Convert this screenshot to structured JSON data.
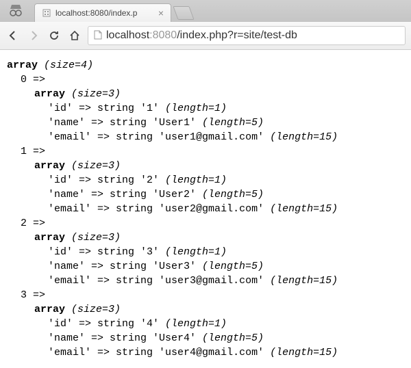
{
  "browser": {
    "tab_title": "localhost:8080/index.p",
    "url_host": "localhost",
    "url_port": ":8080",
    "url_path": "/index.php?r=site/test-db"
  },
  "dump": {
    "keyword_array": "array",
    "keyword_size_open": "(size=",
    "keyword_size_close": ")",
    "keyword_string": "string",
    "keyword_length_open": "(length=",
    "keyword_length_close": ")",
    "arrow": "=>",
    "outer_size": "4",
    "inner_size": "3",
    "items": [
      {
        "index": "0",
        "fields": [
          {
            "key": "'id'",
            "value": "'1'",
            "len": "1"
          },
          {
            "key": "'name'",
            "value": "'User1'",
            "len": "5"
          },
          {
            "key": "'email'",
            "value": "'user1@gmail.com'",
            "len": "15"
          }
        ]
      },
      {
        "index": "1",
        "fields": [
          {
            "key": "'id'",
            "value": "'2'",
            "len": "1"
          },
          {
            "key": "'name'",
            "value": "'User2'",
            "len": "5"
          },
          {
            "key": "'email'",
            "value": "'user2@gmail.com'",
            "len": "15"
          }
        ]
      },
      {
        "index": "2",
        "fields": [
          {
            "key": "'id'",
            "value": "'3'",
            "len": "1"
          },
          {
            "key": "'name'",
            "value": "'User3'",
            "len": "5"
          },
          {
            "key": "'email'",
            "value": "'user3@gmail.com'",
            "len": "15"
          }
        ]
      },
      {
        "index": "3",
        "fields": [
          {
            "key": "'id'",
            "value": "'4'",
            "len": "1"
          },
          {
            "key": "'name'",
            "value": "'User4'",
            "len": "5"
          },
          {
            "key": "'email'",
            "value": "'user4@gmail.com'",
            "len": "15"
          }
        ]
      }
    ]
  }
}
